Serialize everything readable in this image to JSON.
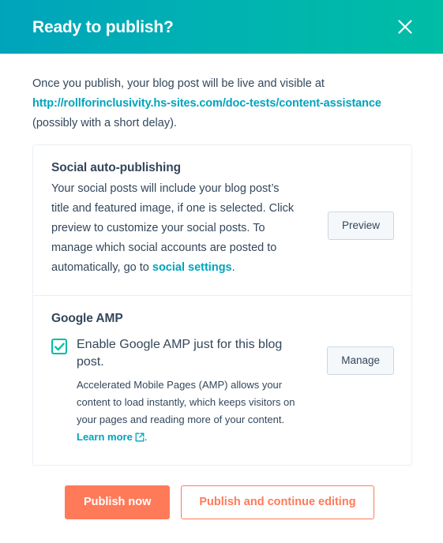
{
  "header": {
    "title": "Ready to publish?",
    "close_icon": "close-icon",
    "gradient_start": "#00a3bb",
    "gradient_end": "#00bda5"
  },
  "intro": {
    "before_link": "Once you publish, your blog post will be live and visible at ",
    "url": "http://rollforinclusivity.hs-sites.com/doc-tests/content-assistance",
    "after_link": "(possibly with a short delay)."
  },
  "social_section": {
    "heading": "Social auto-publishing",
    "body_before_link": "Your social posts will include your blog post’s title and featured image, if one is selected. Click preview to customize your social posts. To manage which social accounts are posted to automatically, go to ",
    "link_label": "social settings",
    "body_after_link": ".",
    "preview_button": "Preview"
  },
  "amp_section": {
    "heading": "Google AMP",
    "checkbox_checked": true,
    "checkbox_icon": "checkmark-icon",
    "checkbox_label": "Enable Google AMP just for this blog post.",
    "description_before_link": "Accelerated Mobile Pages (AMP) allows your content to load instantly, which keeps visitors on your pages and reading more of your content. ",
    "learn_more_label": "Learn more",
    "external_link_icon": "external-link-icon",
    "description_after_link": ".",
    "manage_button": "Manage"
  },
  "footer": {
    "publish_now_label": "Publish now",
    "publish_continue_label": "Publish and continue editing",
    "primary_color": "#ff7a59"
  },
  "theme": {
    "link_color": "#00a4bd",
    "text_color": "#33475b",
    "accent_teal": "#00bda5",
    "border_color": "#eaf0f6"
  }
}
